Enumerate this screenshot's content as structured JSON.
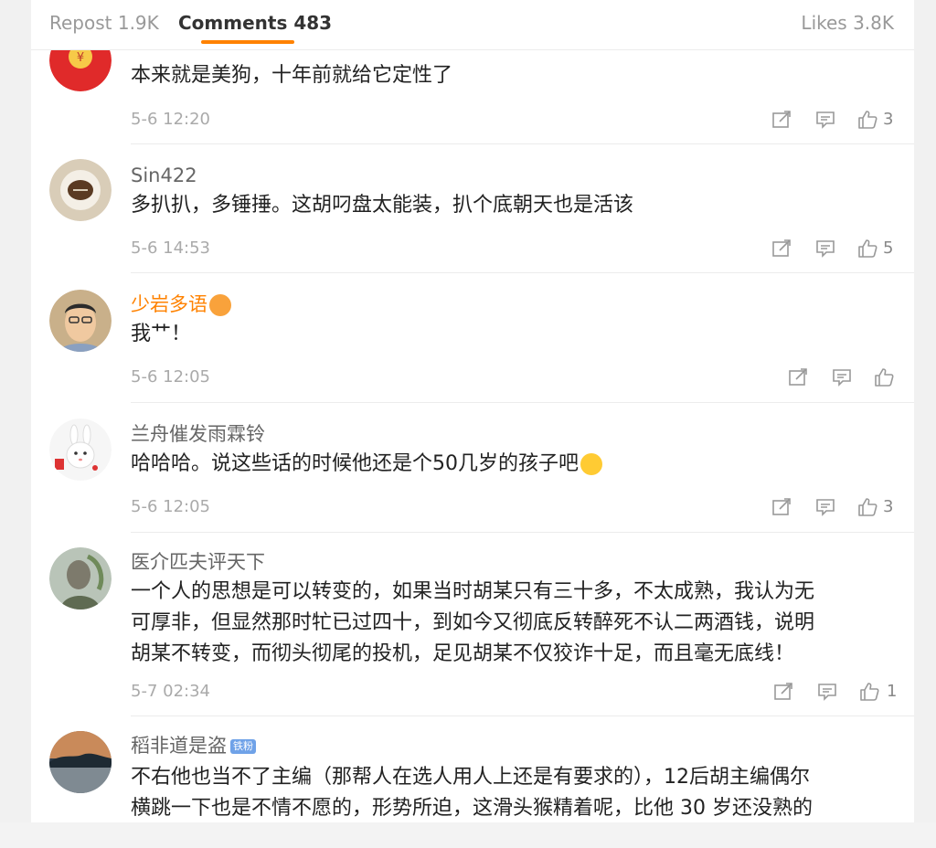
{
  "tabs": {
    "repost": "Repost 1.9K",
    "comments": "Comments 483",
    "likes": "Likes 3.8K"
  },
  "comments": [
    {
      "username": "",
      "text": "本来就是美狗，十年前就给它定性了",
      "time": "5-6 12:20",
      "likes": "3"
    },
    {
      "username": "Sin422",
      "text": "多扒扒，多锤捶。这胡叼盘太能装，扒个底朝天也是活该",
      "time": "5-6 14:53",
      "likes": "5"
    },
    {
      "username": "少岩多语",
      "text": "我艹！",
      "time": "5-6 12:05",
      "likes": ""
    },
    {
      "username": "兰舟催发雨霖铃",
      "text": "哈哈哈。说这些话的时候他还是个50几岁的孩子吧",
      "time": "5-6 12:05",
      "likes": "3"
    },
    {
      "username": "医介匹夫评天下",
      "text_lines": [
        "一个人的思想是可以转变的，如果当时胡某只有三十多，不太成熟，我认为无",
        "可厚非，但显然那时牤已过四十，到如今又彻底反转醉死不认二两酒钱，说明",
        "胡某不转变，而彻头彻尾的投机，足见胡某不仅狡诈十足，而且毫无底线！"
      ],
      "time": "5-7 02:34",
      "likes": "1"
    },
    {
      "username": "稻非道是盗",
      "badge": "铁粉",
      "text_lines": [
        "不右他也当不了主编（那帮人在选人用人上还是有要求的），12后胡主编偶尔",
        "横跳一下也是不情不愿的，形势所迫，这滑头猴精着呢，比他 30 岁还没熟的"
      ]
    }
  ],
  "icons": [
    "share-icon",
    "comment-icon",
    "like-icon"
  ],
  "colors": {
    "accent": "#ff8200",
    "vip_name": "#ff8200",
    "text": "#222222",
    "meta": "#aaaaaa"
  }
}
